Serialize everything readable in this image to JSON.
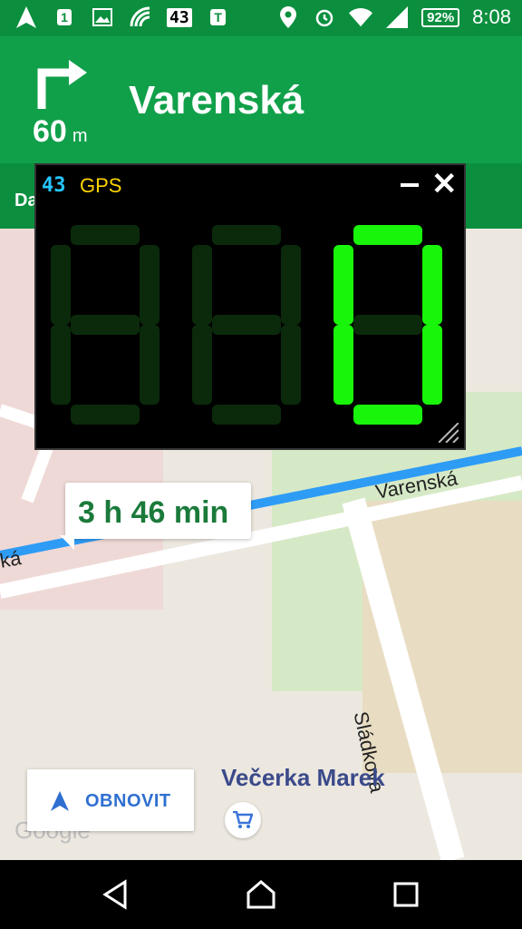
{
  "status_bar": {
    "badge_calendar": "1",
    "speed_box": "43",
    "badge_t": "T",
    "battery": "92%",
    "time": "8:08"
  },
  "navigation": {
    "distance_value": "60",
    "distance_unit": "m",
    "street_name": "Varenská",
    "sub_text": "Da"
  },
  "speedometer": {
    "small_speed": "43",
    "source": "GPS",
    "digits": [
      "8",
      "8",
      "0"
    ],
    "active_color": "#19f50a",
    "inactive_color": "#0b2a0b"
  },
  "map": {
    "eta": "3 h 46 min",
    "road_label_main": "Varenská",
    "road_label_left": "ká",
    "road_label_side": "Sládkova",
    "poi_name": "Večerka Marek",
    "watermark": "Google",
    "route_color": "#2e9cf5"
  },
  "buttons": {
    "obnovit": "OBNOVIT"
  }
}
